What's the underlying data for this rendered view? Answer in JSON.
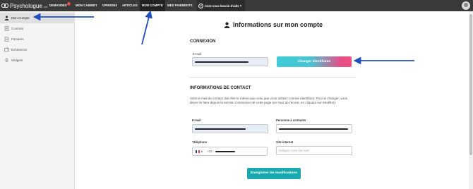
{
  "topbar": {
    "logo_text": "Psychologue",
    "logo_suffix": ".net",
    "nav": [
      {
        "label": "DEMANDES",
        "badge": "1"
      },
      {
        "label": "MON CABINET"
      },
      {
        "label": "OPINIONS"
      },
      {
        "label": "ARTICLES"
      },
      {
        "label": "MON COMPTE"
      },
      {
        "label": "MES PAIEMENTS"
      }
    ],
    "help_label": "Avez-vous besoin d'aide ?"
  },
  "sidebar": {
    "items": [
      {
        "label": "Mon Compte",
        "icon": "user-icon"
      },
      {
        "label": "Contrats",
        "icon": "contract-icon"
      },
      {
        "label": "Factures",
        "icon": "invoice-icon"
      },
      {
        "label": "Echéances",
        "icon": "wallet-icon"
      },
      {
        "label": "Widgets",
        "icon": "widget-icon"
      }
    ]
  },
  "page": {
    "title": "Informations sur mon compte"
  },
  "connexion": {
    "heading": "CONNEXION",
    "email_label": "E-mail",
    "change_button": "Changer identifiants"
  },
  "contact": {
    "heading": "INFORMATIONS DE CONTACT",
    "description": "Votre e-mail de contact doit être le même que celui que vous utilisez comme identifiant. Pour le changer, vous devez le faire depuis la section Connexion de cette page (en haut de l'écran, en cliquant sur Modifier).",
    "email_label": "E-mail",
    "person_label": "Personne à contacter",
    "phone_label": "Téléphone",
    "phone_country_code": "+33",
    "website_label": "Site internet",
    "website_placeholder": "Indiquez votre site web",
    "save_button": "Enregistrer les modifications"
  },
  "colors": {
    "topbar": "#3a3a3a",
    "accent_teal": "#1aa9ae",
    "gradient_start": "#3ecbd6",
    "gradient_end": "#ee4f7e",
    "annotation_arrow": "#1f4fbf"
  }
}
